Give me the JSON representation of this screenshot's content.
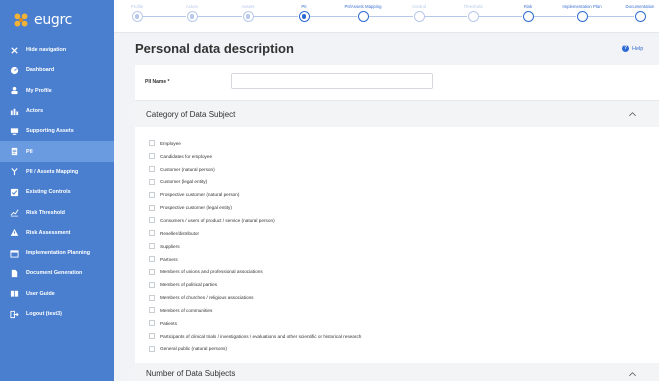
{
  "app": {
    "logo_text": "eugrc"
  },
  "colors": {
    "sidebar": "#4a7fd0",
    "sidebar_active": "#6a9be0",
    "accent": "#2f6bd4",
    "step_inactive": "#b7c8ea"
  },
  "sidebar": {
    "items": [
      {
        "label": "Hide navigation",
        "icon": "close-icon"
      },
      {
        "label": "Dashboard",
        "icon": "dashboard-icon"
      },
      {
        "label": "My Profile",
        "icon": "user-icon"
      },
      {
        "label": "Actors",
        "icon": "actors-icon"
      },
      {
        "label": "Supporting Assets",
        "icon": "assets-icon"
      },
      {
        "label": "PII",
        "icon": "document-icon"
      },
      {
        "label": "PII / Assets Mapping",
        "icon": "mapping-icon"
      },
      {
        "label": "Existing Controls",
        "icon": "checkbox-icon"
      },
      {
        "label": "Risk Threshold",
        "icon": "threshold-icon"
      },
      {
        "label": "Risk Assessment",
        "icon": "warning-icon"
      },
      {
        "label": "Implementation Planning",
        "icon": "calendar-icon"
      },
      {
        "label": "Document Generation",
        "icon": "file-icon"
      },
      {
        "label": "User Guide",
        "icon": "book-icon"
      },
      {
        "label": "Logout (test3)",
        "icon": "logout-icon"
      }
    ],
    "active_index": 5
  },
  "steps": {
    "items": [
      {
        "label": "Profile",
        "state": "done"
      },
      {
        "label": "Actors",
        "state": "done"
      },
      {
        "label": "Assets",
        "state": "done"
      },
      {
        "label": "PII",
        "state": "current"
      },
      {
        "label": "PII/Assets Mapping",
        "state": "todo"
      },
      {
        "label": "Control",
        "state": "inactive"
      },
      {
        "label": "Threshold",
        "state": "inactive"
      },
      {
        "label": "Risk",
        "state": "todo"
      },
      {
        "label": "Implementation Plan",
        "state": "todo"
      },
      {
        "label": "Documentation",
        "state": "todo"
      }
    ]
  },
  "main": {
    "title": "Personal data description",
    "help_label": "Help",
    "pii_name_label": "PII Name *",
    "pii_name_value": "",
    "category_section_title": "Category of Data Subject",
    "categories": [
      "Employee",
      "Candidates for employee",
      "Customer (natural person)",
      "Customer (legal entity)",
      "Prospective customer (natural person)",
      "Prospective customer (legal entity)",
      "Consumers / users of product / service (natural person)",
      "Reseller/distributor",
      "Suppliers",
      "Partners",
      "Members of unions and professional associations",
      "Members of political parties",
      "Members of churches / religious associations",
      "Members of communities",
      "Patients",
      "Participants of clinical trials / investigations / evaluations and other scientific or historical research",
      "General public (natural persons)"
    ],
    "number_section_title": "Number of Data Subjects"
  }
}
